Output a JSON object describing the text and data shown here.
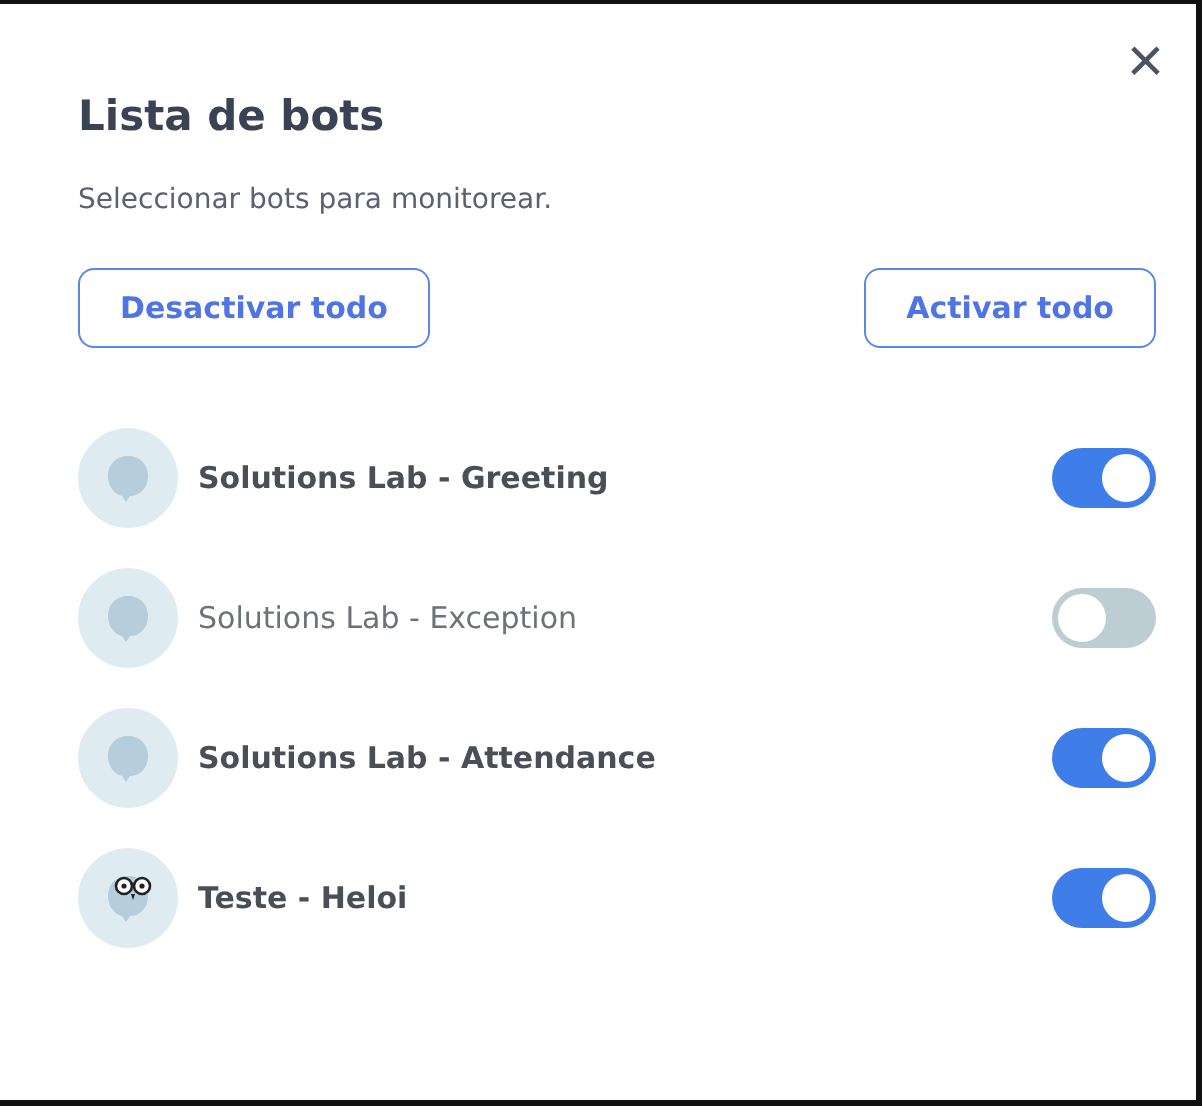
{
  "dialog": {
    "title": "Lista de bots",
    "subtitle": "Seleccionar bots para monitorear.",
    "close": "×"
  },
  "buttons": [
    "Desactivar todo",
    "Activar todo"
  ],
  "bots": [
    {
      "name": "Solutions Lab - Greeting",
      "on": true,
      "kind": "chat"
    },
    {
      "name": "Solutions Lab - Exception",
      "on": false,
      "kind": "chat"
    },
    {
      "name": "Solutions Lab - Attendance",
      "on": true,
      "kind": "chat"
    },
    {
      "name": "Teste - Heloi",
      "on": true,
      "kind": "owl"
    }
  ]
}
